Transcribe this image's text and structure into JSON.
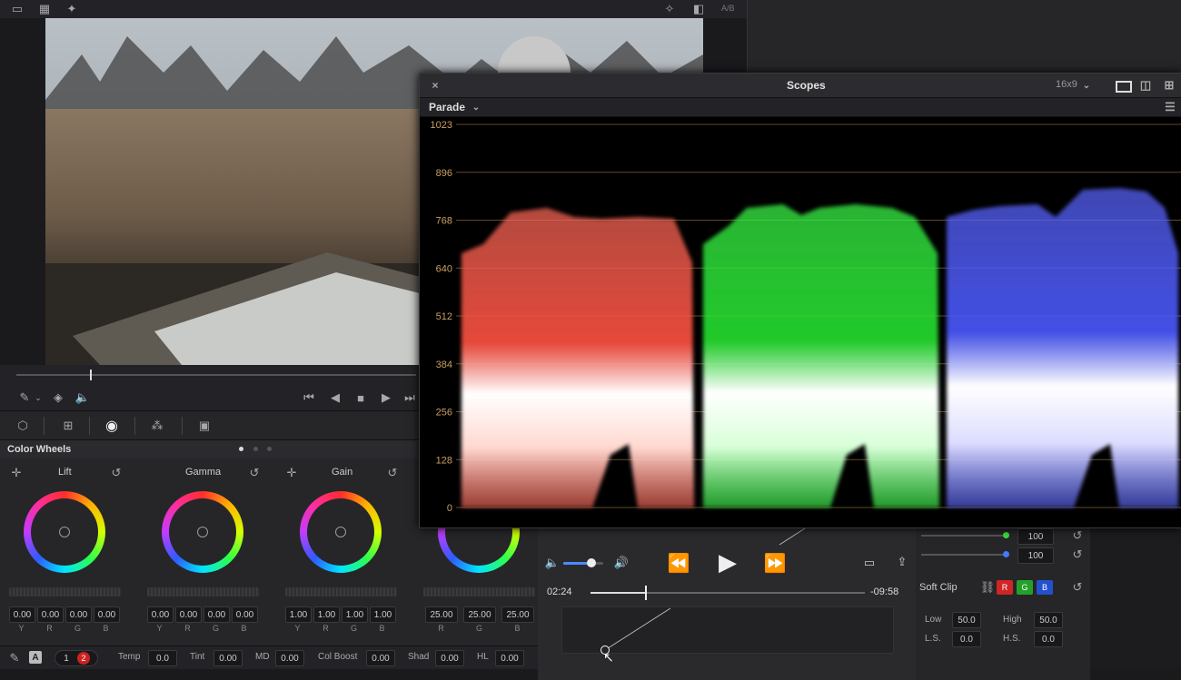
{
  "scopes": {
    "title": "Scopes",
    "aspect": "16x9",
    "mode": "Parade",
    "scale_labels": [
      "1023",
      "896",
      "768",
      "640",
      "512",
      "384",
      "256",
      "128",
      "0"
    ]
  },
  "color_wheels": {
    "title": "Color Wheels",
    "wheels": [
      {
        "name": "Lift",
        "values": [
          "0.00",
          "0.00",
          "0.00",
          "0.00"
        ]
      },
      {
        "name": "Gamma",
        "values": [
          "0.00",
          "0.00",
          "0.00",
          "0.00"
        ]
      },
      {
        "name": "Gain",
        "values": [
          "1.00",
          "1.00",
          "1.00",
          "1.00"
        ]
      },
      {
        "name": "",
        "values": [
          "25.00",
          "25.00",
          "25.00"
        ]
      }
    ],
    "channel_labels4": [
      "Y",
      "R",
      "G",
      "B"
    ],
    "channel_labels3": [
      "R",
      "G",
      "B"
    ]
  },
  "bottom_bar": {
    "page1": "1",
    "page2": "2",
    "auto": "A",
    "temp_label": "Temp",
    "temp_value": "0.0",
    "tint_label": "Tint",
    "tint_value": "0.00",
    "md_label": "MD",
    "md_value": "0.00",
    "colboost_label": "Col Boost",
    "colboost_value": "0.00",
    "shad_label": "Shad",
    "shad_value": "0.00",
    "hl_label": "HL",
    "hl_value": "0.00"
  },
  "player": {
    "elapsed": "02:24",
    "remaining": "-09:58",
    "volume": 0.7,
    "progress": 0.2
  },
  "right_panel": {
    "val1": "100",
    "val2": "100",
    "soft_clip_label": "Soft Clip",
    "btn_r": "R",
    "btn_g": "G",
    "btn_b": "B",
    "low_label": "Low",
    "low_value": "50.0",
    "high_label": "High",
    "high_value": "50.0",
    "ls_label": "L.S.",
    "ls_value": "0.0",
    "hs_label": "H.S.",
    "hs_value": "0.0"
  },
  "topbar": {
    "ab_label": "A/B"
  },
  "colors": {
    "red_channel": "#ff6a5a",
    "green_channel": "#3cff4a",
    "blue_channel": "#5a66ff",
    "accent_blue": "#4a8cff"
  }
}
